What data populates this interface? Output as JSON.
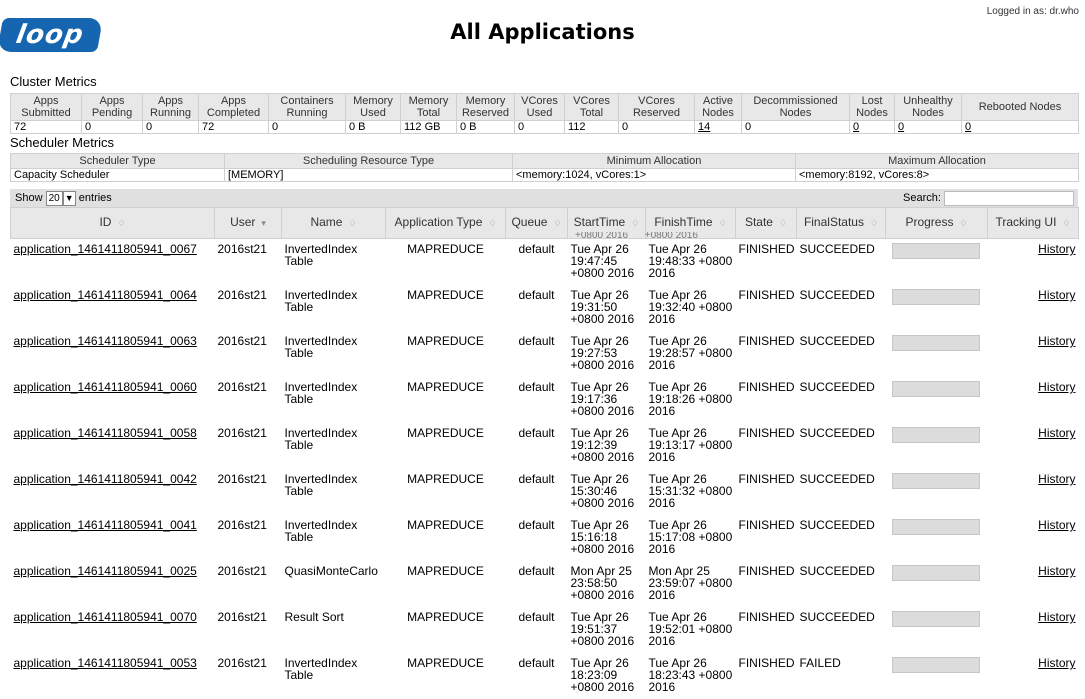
{
  "header": {
    "logo_text": "loop",
    "title": "All Applications",
    "logged_in": "Logged in as: dr.who"
  },
  "cluster_metrics": {
    "label": "Cluster Metrics",
    "columns": [
      "Apps Submitted",
      "Apps Pending",
      "Apps Running",
      "Apps Completed",
      "Containers Running",
      "Memory Used",
      "Memory Total",
      "Memory Reserved",
      "VCores Used",
      "VCores Total",
      "VCores Reserved",
      "Active Nodes",
      "Decommissioned Nodes",
      "Lost Nodes",
      "Unhealthy Nodes",
      "Rebooted Nodes"
    ],
    "values": [
      "72",
      "0",
      "0",
      "72",
      "0",
      "0 B",
      "112 GB",
      "0 B",
      "0",
      "112",
      "0",
      "14",
      "0",
      "0",
      "0",
      "0"
    ]
  },
  "scheduler_metrics": {
    "label": "Scheduler Metrics",
    "columns": [
      "Scheduler Type",
      "Scheduling Resource Type",
      "Minimum Allocation",
      "Maximum Allocation"
    ],
    "values": [
      "Capacity Scheduler",
      "[MEMORY]",
      "<memory:1024, vCores:1>",
      "<memory:8192, vCores:8>"
    ]
  },
  "table_controls": {
    "show_label": "Show",
    "entries_value": "20",
    "entries_label": "entries",
    "search_label": "Search:",
    "search_value": ""
  },
  "apps_table": {
    "columns": [
      "ID",
      "User",
      "Name",
      "Application Type",
      "Queue",
      "StartTime",
      "FinishTime",
      "State",
      "FinalStatus",
      "Progress",
      "Tracking UI"
    ],
    "rows": [
      {
        "id": "application_1461411805941_0067",
        "user": "2016st21",
        "name": "InvertedIndex Table",
        "type": "MAPREDUCE",
        "queue": "default",
        "start": "Tue Apr 26 19:47:45 +0800 2016",
        "finish": "Tue Apr 26 19:48:33 +0800 2016",
        "state": "FINISHED",
        "final": "SUCCEEDED",
        "tracking": "History"
      },
      {
        "id": "application_1461411805941_0064",
        "user": "2016st21",
        "name": "InvertedIndex Table",
        "type": "MAPREDUCE",
        "queue": "default",
        "start": "Tue Apr 26 19:31:50 +0800 2016",
        "finish": "Tue Apr 26 19:32:40 +0800 2016",
        "state": "FINISHED",
        "final": "SUCCEEDED",
        "tracking": "History"
      },
      {
        "id": "application_1461411805941_0063",
        "user": "2016st21",
        "name": "InvertedIndex Table",
        "type": "MAPREDUCE",
        "queue": "default",
        "start": "Tue Apr 26 19:27:53 +0800 2016",
        "finish": "Tue Apr 26 19:28:57 +0800 2016",
        "state": "FINISHED",
        "final": "SUCCEEDED",
        "tracking": "History"
      },
      {
        "id": "application_1461411805941_0060",
        "user": "2016st21",
        "name": "InvertedIndex Table",
        "type": "MAPREDUCE",
        "queue": "default",
        "start": "Tue Apr 26 19:17:36 +0800 2016",
        "finish": "Tue Apr 26 19:18:26 +0800 2016",
        "state": "FINISHED",
        "final": "SUCCEEDED",
        "tracking": "History"
      },
      {
        "id": "application_1461411805941_0058",
        "user": "2016st21",
        "name": "InvertedIndex Table",
        "type": "MAPREDUCE",
        "queue": "default",
        "start": "Tue Apr 26 19:12:39 +0800 2016",
        "finish": "Tue Apr 26 19:13:17 +0800 2016",
        "state": "FINISHED",
        "final": "SUCCEEDED",
        "tracking": "History"
      },
      {
        "id": "application_1461411805941_0042",
        "user": "2016st21",
        "name": "InvertedIndex Table",
        "type": "MAPREDUCE",
        "queue": "default",
        "start": "Tue Apr 26 15:30:46 +0800 2016",
        "finish": "Tue Apr 26 15:31:32 +0800 2016",
        "state": "FINISHED",
        "final": "SUCCEEDED",
        "tracking": "History"
      },
      {
        "id": "application_1461411805941_0041",
        "user": "2016st21",
        "name": "InvertedIndex Table",
        "type": "MAPREDUCE",
        "queue": "default",
        "start": "Tue Apr 26 15:16:18 +0800 2016",
        "finish": "Tue Apr 26 15:17:08 +0800 2016",
        "state": "FINISHED",
        "final": "SUCCEEDED",
        "tracking": "History"
      },
      {
        "id": "application_1461411805941_0025",
        "user": "2016st21",
        "name": "QuasiMonteCarlo",
        "type": "MAPREDUCE",
        "queue": "default",
        "start": "Mon Apr 25 23:58:50 +0800 2016",
        "finish": "Mon Apr 25 23:59:07 +0800 2016",
        "state": "FINISHED",
        "final": "SUCCEEDED",
        "tracking": "History"
      },
      {
        "id": "application_1461411805941_0070",
        "user": "2016st21",
        "name": "Result Sort",
        "type": "MAPREDUCE",
        "queue": "default",
        "start": "Tue Apr 26 19:51:37 +0800 2016",
        "finish": "Tue Apr 26 19:52:01 +0800 2016",
        "state": "FINISHED",
        "final": "SUCCEEDED",
        "tracking": "History"
      },
      {
        "id": "application_1461411805941_0053",
        "user": "2016st21",
        "name": "InvertedIndex Table",
        "type": "MAPREDUCE",
        "queue": "default",
        "start": "Tue Apr 26 18:23:09 +0800 2016",
        "finish": "Tue Apr 26 18:23:43 +0800 2016",
        "state": "FINISHED",
        "final": "FAILED",
        "tracking": "History"
      }
    ]
  }
}
